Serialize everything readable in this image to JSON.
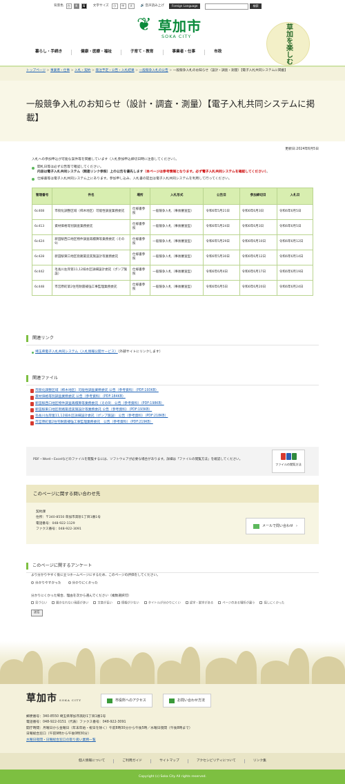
{
  "util": {
    "color_label": "背景色",
    "colors": [
      "白",
      "黒",
      "青"
    ],
    "size_label": "文字サイズ",
    "sizes": [
      "小",
      "中",
      "大"
    ],
    "speak": "音声読み上げ",
    "foreign": "Foreign Language",
    "search_placeholder": "",
    "search_btn": "検索"
  },
  "logo": {
    "name": "草加市",
    "en": "SOKA CITY",
    "badge": "草加を楽しむ"
  },
  "nav": [
    "暮らし・手続き",
    "健康・医療・福祉",
    "子育て・教育",
    "事業者・仕事",
    "市政"
  ],
  "breadcrumb": {
    "links": [
      "トップページ",
      "事業者・仕事",
      "入札・契約",
      "発注予定・公告・入札結果",
      "一般競争入札の公告"
    ],
    "current": "一般競争入札のお知らせ（設計・調査・測量）【電子入札共同システムに掲載】"
  },
  "title": "一般競争入札のお知らせ（設計・調査・測量）【電子入札共同システムに掲載】",
  "updated": "更新日:2024年6月5日",
  "lead": "入札への参加申込が可能な案件等を掲載しています（入札参加申込締切日時に注意してください）。",
  "bullets": {
    "b1": "開札日等は必ず公告等で確認してください。",
    "b1b": "内容は電子入札共同システム（関連リンク参照）上の公告を優先します",
    "b1red": "（本ページは参考情報となります。必ず電子入札共同システムを確認してください）",
    "b1end": "。",
    "b2": "仕様書等は電子入札共同システム上にあります。参加申し込み、入札書の提出は電子入札共同システムを利用して行ってください。"
  },
  "table": {
    "headers": [
      "管理番号",
      "件名",
      "場所",
      "入札形式",
      "公告日",
      "参加締切日",
      "入札日"
    ],
    "rows": [
      [
        "6c408",
        "市街化調整区域（柿木地区）可能性調査業務委託",
        "仕様書参照",
        "一般競争入札（事後審査型）",
        "令和6年5月21日",
        "令和6年6月3日",
        "令和6年6月5日"
      ],
      [
        "6c413",
        "資材価格等別調査業務委託",
        "仕様書参照",
        "一般競争入札（事後審査型）",
        "令和6年5月24日",
        "令和6年6月3日",
        "令和6年6月5日"
      ],
      [
        "6c424",
        "新田駅西口地区物件調査再積算等業務委託（その9）",
        "仕様書参照",
        "一般競争入札（事後審査型）",
        "令和6年5月29日",
        "令和6年6月10日",
        "令和6年6月12日"
      ],
      [
        "6c428",
        "新田駅東口地区街路築造実施設計等業務委託",
        "仕様書参照",
        "一般競争入札（事後審査型）",
        "令和6年5月30日",
        "令和6年6月12日",
        "令和6年6月14日"
      ],
      [
        "6c442",
        "毛長川左岸第11,12排水区詳細設計委託（ポンプ施設）",
        "仕様書参照",
        "一般競争入札（事後審査型）",
        "令和6年6月4日",
        "令和6年6月17日",
        "令和6年6月19日"
      ],
      [
        "6c448",
        "市営原町第2住宅耐震補強工事監理業務委託",
        "仕様書参照",
        "一般競争入札（事後審査型）",
        "令和6年6月5日",
        "令和6年6月20日",
        "令和6年6月24日"
      ]
    ]
  },
  "related_links": {
    "heading": "関連リンク",
    "link": "埼玉県電子入札共同システム（入札情報公開サービス）",
    "note": "（外部サイトにリンクします）"
  },
  "related_files": {
    "heading": "関連ファイル",
    "files": [
      "市街化調整区域（柿木地区）可能性調査業務委託 公告（参考資料）（PDF:193KB）",
      "資材価格等別調査業務委託 公告（参考資料）（PDF:184KB）",
      "新田駅西口地区物件調査再積算等業務委託（その9） 公告（参考資料）（PDF:198KB）",
      "新田駅東口地区街路築造実施設計等業務委託 公告（参考資料）（PDF:193KB）",
      "毛長川左岸第11,12排水区詳細設計委託（ポンプ施設） 公告（参考資料）（PDF:218KB）",
      "市営原町第2住宅耐震補強工事監理業務委託　公告（参考資料）（PDF:219KB）"
    ]
  },
  "viewer": {
    "text": "PDF・Word・Excelなどのファイルを閲覧するには、ソフトウェアが必要な場合があります。詳細は「ファイルの閲覧方法」を確認してください。",
    "button": "ファイルの閲覧方法"
  },
  "contact": {
    "heading": "このページに関する問い合わせ先",
    "dept": "契約課",
    "address": "住所：〒340-8550 草加市高砂1丁目1番1号",
    "tel": "電話番号：048-922-1129",
    "fax": "ファクス番号：048-922-3091",
    "mail_btn": "メールで問い合わせ"
  },
  "survey": {
    "heading": "このページに関するアンケート",
    "q1": "より分かりやすく役に立つホームページにするため、このページの評価をしてください。",
    "r1": "分かりやすかった",
    "r2": "分かりにくかった",
    "q2": "分かりにくかった場合、理由を次から選んでください（複数選択可）",
    "reasons": [
      "見づらい",
      "聞きなれない用語が多い",
      "文章が長い",
      "情報が少ない",
      "タイトルが分かりにくい",
      "誤字・脱字がある",
      "ページのある場所が違う",
      "探しにくかった"
    ],
    "submit": "送信"
  },
  "footer": {
    "logo": "草加市",
    "logo_en": "SOKA CITY",
    "access": "市役所へのアクセス",
    "inquiry": "お問い合わせ方法",
    "addr": "郵便番号：340-8550 埼玉県草加市高砂1丁目1番1号",
    "tel": "電話番号：048-922-0151（代表）ファクス番号：048-922-3091",
    "hours": "開庁時間：月曜日から金曜日（年末年始・祝日を除く）午前8時30分から午後5時／水曜日夜間（午後8時まで）",
    "sun": "日曜総合窓口（午前9時から午後0時30分）",
    "link": "水曜日夜間・日曜総合窓口の取り扱い業務一覧",
    "nav": [
      "個人情報について",
      "ご利用ガイド",
      "サイトマップ",
      "アクセシビリティについて",
      "リンク集"
    ],
    "copyright": "Copyright (c) Soka City All rights reserved."
  }
}
